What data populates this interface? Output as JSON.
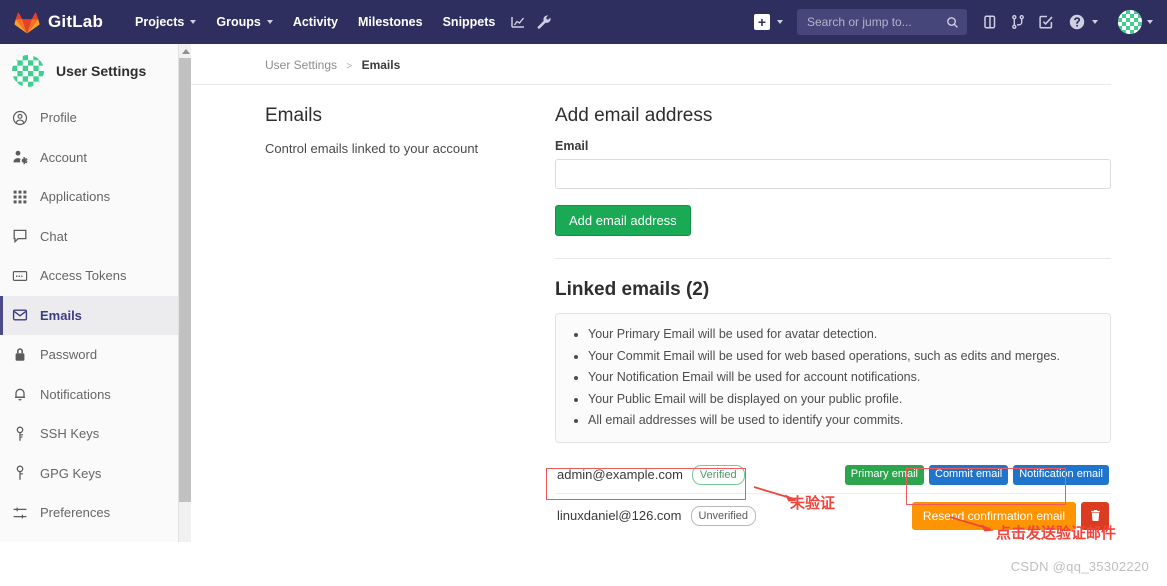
{
  "navbar": {
    "brand": "GitLab",
    "logo_icon": "gitlab-tanuki-icon",
    "items": [
      {
        "label": "Projects",
        "caret": true,
        "icon": ""
      },
      {
        "label": "Groups",
        "caret": true,
        "icon": ""
      },
      {
        "label": "Activity",
        "caret": false,
        "icon": ""
      },
      {
        "label": "Milestones",
        "caret": false,
        "icon": ""
      },
      {
        "label": "Snippets",
        "caret": false,
        "icon": ""
      }
    ],
    "left_icons": [
      {
        "name": "chart-icon"
      },
      {
        "name": "wrench-icon"
      }
    ],
    "create_new_icon": "plus-square-icon",
    "search": {
      "placeholder": "Search or jump to...",
      "value": "",
      "icon": "search-icon"
    },
    "right_icons": [
      {
        "name": "issues-icon"
      },
      {
        "name": "merge-request-icon"
      },
      {
        "name": "todos-icon"
      },
      {
        "name": "help-icon"
      }
    ],
    "avatar_icon": "user-avatar-identicon",
    "background_color": "#2e2e5f"
  },
  "sidebar": {
    "avatar_icon": "user-avatar-identicon",
    "title": "User Settings",
    "items": [
      {
        "label": "Profile",
        "icon": "user-circle-icon",
        "active": false
      },
      {
        "label": "Account",
        "icon": "user-gear-icon",
        "active": false
      },
      {
        "label": "Applications",
        "icon": "grid-apps-icon",
        "active": false
      },
      {
        "label": "Chat",
        "icon": "chat-bubble-icon",
        "active": false
      },
      {
        "label": "Access Tokens",
        "icon": "token-card-icon",
        "active": false
      },
      {
        "label": "Emails",
        "icon": "envelope-icon",
        "active": true
      },
      {
        "label": "Password",
        "icon": "lock-icon",
        "active": false
      },
      {
        "label": "Notifications",
        "icon": "bell-icon",
        "active": false
      },
      {
        "label": "SSH Keys",
        "icon": "key-icon",
        "active": false
      },
      {
        "label": "GPG Keys",
        "icon": "key-icon",
        "active": false
      },
      {
        "label": "Preferences",
        "icon": "sliders-icon",
        "active": false
      }
    ],
    "active_accent_color": "#4a4a8a"
  },
  "breadcrumb": {
    "root": "User Settings",
    "separator": ">",
    "current": "Emails"
  },
  "emails_section": {
    "title": "Emails",
    "description": "Control emails linked to your account"
  },
  "add_email": {
    "title": "Add email address",
    "field_label": "Email",
    "input_value": "",
    "input_placeholder": "",
    "submit_label": "Add email address",
    "submit_color": "#1aaa55"
  },
  "linked_emails": {
    "title": "Linked emails (2)",
    "notices": [
      "Your Primary Email will be used for avatar detection.",
      "Your Commit Email will be used for web based operations, such as edits and merges.",
      "Your Notification Email will be used for account notifications.",
      "Your Public Email will be displayed on your public profile.",
      "All email addresses will be used to identify your commits."
    ],
    "rows": [
      {
        "address": "admin@example.com",
        "status_badge": "Verified",
        "status_style": "outline-green",
        "tags": [
          {
            "label": "Primary email",
            "color": "#2da44e"
          },
          {
            "label": "Commit email",
            "color": "#1f75cb"
          },
          {
            "label": "Notification email",
            "color": "#1f75cb"
          }
        ],
        "resend_label": "",
        "has_resend": false,
        "has_delete": false
      },
      {
        "address": "linuxdaniel@126.com",
        "status_badge": "Unverified",
        "status_style": "outline-gray",
        "tags": [],
        "resend_label": "Resend confirmation email",
        "has_resend": true,
        "has_delete": true,
        "delete_icon": "trash-icon"
      }
    ]
  },
  "annotations": {
    "color": "#f2453d",
    "unverified_note": "未验证",
    "resend_note": "点击发送验证邮件"
  },
  "watermark": "CSDN @qq_35302220"
}
